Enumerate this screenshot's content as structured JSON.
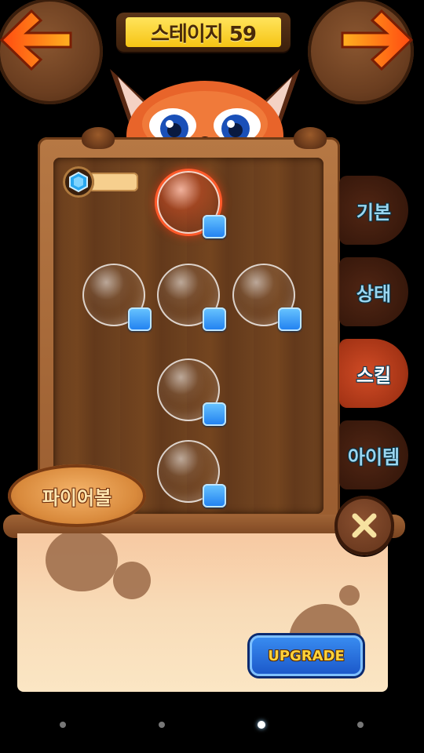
{
  "header": {
    "stage_title": "스테이지 59",
    "prev_icon": "arrow-left-icon",
    "next_icon": "arrow-right-icon"
  },
  "counter": {
    "icon": "blue-gem-icon",
    "value": ""
  },
  "skills": [
    {
      "slot": "top",
      "selected": true
    },
    {
      "slot": "middle-left",
      "selected": false
    },
    {
      "slot": "middle-center",
      "selected": false
    },
    {
      "slot": "middle-right",
      "selected": false
    },
    {
      "slot": "lower-center",
      "selected": false
    },
    {
      "slot": "bottom-center",
      "selected": false
    }
  ],
  "tabs": [
    {
      "label": "기본",
      "active": false
    },
    {
      "label": "상태",
      "active": false
    },
    {
      "label": "스킬",
      "active": true
    },
    {
      "label": "아이템",
      "active": false
    }
  ],
  "skill_name": "파이어볼",
  "close_icon": "close-icon",
  "upgrade_label": "UPGRADE",
  "pager": {
    "count": 4,
    "active_index": 2
  },
  "colors": {
    "accent_orange": "#e8542a",
    "upgrade_blue": "#1a56c8",
    "gold_text": "#ffd23a",
    "title_yellow": "#f6c414"
  }
}
